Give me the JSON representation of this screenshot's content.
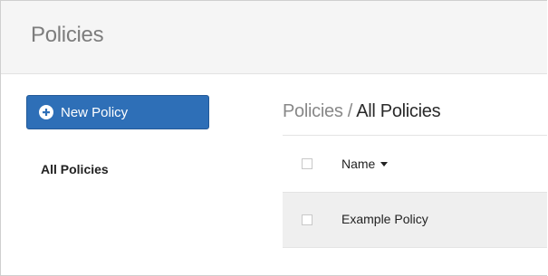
{
  "header": {
    "title": "Policies"
  },
  "sidebar": {
    "new_button_label": "New Policy",
    "new_button_icon": "plus-circle-icon",
    "items": [
      {
        "label": "All Policies",
        "active": true
      }
    ]
  },
  "main": {
    "breadcrumb": {
      "parent": "Policies",
      "separator": " / ",
      "current": "All Policies"
    },
    "table": {
      "columns": [
        {
          "label": "Name",
          "sort": "descending"
        }
      ],
      "rows": [
        {
          "name": "Example Policy"
        }
      ]
    }
  },
  "colors": {
    "primary_button": "#2e6fb7",
    "header_bg": "#f5f5f5",
    "row_bg": "#efefef"
  }
}
